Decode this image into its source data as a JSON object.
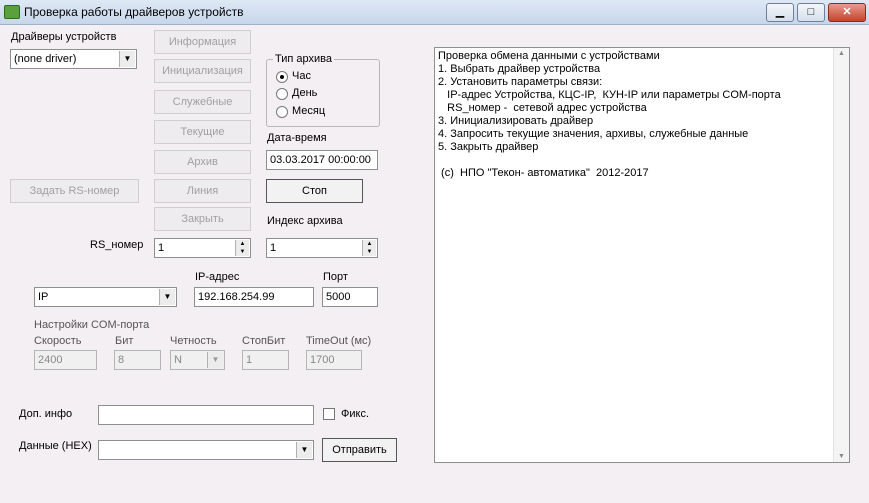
{
  "window": {
    "title": "Проверка работы драйверов устройств",
    "minimize": "▁",
    "maximize": "□",
    "close": "✕"
  },
  "drivers": {
    "label": "Драйверы устройств",
    "selected": "(none driver)"
  },
  "buttons": {
    "info": "Информация",
    "init": "Инициализация",
    "service": "Служебные",
    "current": "Текущие",
    "archive": "Архив",
    "line": "Линия",
    "close": "Закрыть",
    "set_rs": "Задать RS-номер",
    "stop": "Стоп",
    "send": "Отправить"
  },
  "archive_type": {
    "label": "Тип архива",
    "options": [
      "Час",
      "День",
      "Месяц"
    ],
    "selected_index": 0
  },
  "datetime": {
    "label": "Дата-время",
    "value": "03.03.2017 00:00:00"
  },
  "archive_index": {
    "label": "Индекс архива",
    "value": "1"
  },
  "rs_number": {
    "label": "RS_номер",
    "value": "1"
  },
  "connection": {
    "type": "IP",
    "ip_label": "IP-адрес",
    "ip": "192.168.254.99",
    "port_label": "Порт",
    "port": "5000"
  },
  "com": {
    "title": "Настройки COM-порта",
    "speed_label": "Скорость",
    "speed": "2400",
    "bits_label": "Бит",
    "bits": "8",
    "parity_label": "Четность",
    "parity": "N",
    "stopbit_label": "СтопБит",
    "stopbit": "1",
    "timeout_label": "TimeOut (мс)",
    "timeout": "1700"
  },
  "extra": {
    "label": "Доп. инфо",
    "value": "",
    "fix_label": "Фикс."
  },
  "hex": {
    "label": "Данные (HEX)",
    "value": ""
  },
  "log": {
    "lines": [
      "Проверка обмена данными с устройствами",
      "1. Выбрать драйвер устройства",
      "2. Установить параметры связи:",
      "   IP-адрес Устройства, КЦС-IP,  КУН-IP или параметры COM-порта",
      "   RS_номер -  сетевой адрес устройства",
      "3. Инициализировать  драйвер",
      "4. Запросить текущие  значения, архивы,  служебные данные",
      "5. Закрыть драйвер",
      "",
      " (c)  НПО \"Текон- автоматика\"  2012-2017"
    ]
  }
}
